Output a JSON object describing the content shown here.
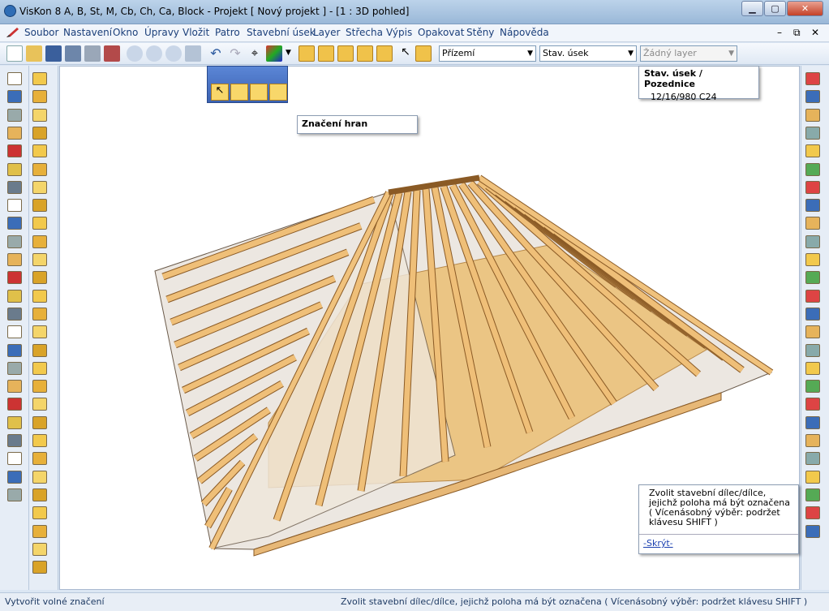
{
  "window": {
    "title": "VisKon 8 A, B, St, M, Cb, Ch, Ca, Block - Projekt [ Nový projekt ]  - [1 : 3D pohled]",
    "minimize": "▁",
    "maximize": "▢",
    "close": "✕"
  },
  "menu": {
    "items": [
      "Soubor",
      "Nastavení",
      "Okno",
      "Úpravy",
      "Vložit",
      "Patro",
      "Stavební úsek",
      "Layer",
      "Střecha",
      "Výpis",
      "Opakovat",
      "Stěny",
      "Nápověda"
    ],
    "doc_controls": [
      "–",
      "⧉",
      "✕"
    ]
  },
  "toolbar": {
    "floor_select": "Přízemí",
    "section_select": "Stav. úsek",
    "layer_select": "Žádný layer"
  },
  "info_popup": {
    "title": "Stav. úsek / Pozednice",
    "value": "12/16/980 C24"
  },
  "tooltip": {
    "text": "Značení hran"
  },
  "hint": {
    "text": "Zvolit stavební dílec/dílce, jejichž poloha má být označena\n( Vícenásobný výběr: podržet klávesu SHIFT )",
    "hide_link": "-Skrýt-"
  },
  "status": {
    "left": "Vytvořit volné značení",
    "right": "Zvolit stavební dílec/dílce, jejichž poloha má být označena ( Vícenásobný výběr: podržet klávesu SHIFT )"
  },
  "colors": {
    "accent": "#1b3f7a",
    "timber": "#e6b46b",
    "timber_dark": "#a06a2b",
    "insulation": "#ece6df",
    "floor": "#e9c07d"
  }
}
